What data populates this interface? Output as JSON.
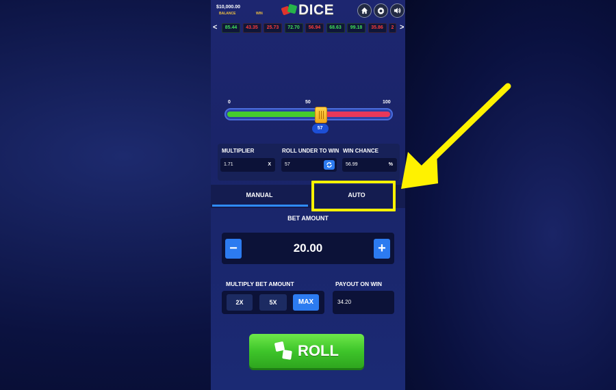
{
  "header": {
    "balance_value": "$10,000.00",
    "balance_label": "BALANCE",
    "win_label": "WIN",
    "logo_text": "DICE",
    "buttons": [
      {
        "name": "home-icon"
      },
      {
        "name": "gear-icon"
      },
      {
        "name": "sound-icon"
      }
    ]
  },
  "history": {
    "prev": "<",
    "next": ">",
    "items": [
      {
        "value": "85.44",
        "result": "win"
      },
      {
        "value": "43.35",
        "result": "loss"
      },
      {
        "value": "25.73",
        "result": "loss"
      },
      {
        "value": "72.70",
        "result": "win"
      },
      {
        "value": "56.94",
        "result": "loss"
      },
      {
        "value": "68.63",
        "result": "win"
      },
      {
        "value": "99.18",
        "result": "win"
      },
      {
        "value": "35.86",
        "result": "loss"
      },
      {
        "value": "2",
        "result": "loss"
      }
    ]
  },
  "slider": {
    "min_label": "0",
    "mid_label": "50",
    "max_label": "100",
    "value": 57,
    "value_label": "57",
    "colors": {
      "under": "#45cc2e",
      "over": "#e8385a"
    }
  },
  "stats": {
    "multiplier_label": "MULTIPLIER",
    "multiplier_value": "1.71",
    "multiplier_suffix": "X",
    "roll_under_label": "ROLL UNDER TO WIN",
    "roll_under_value": "57",
    "win_chance_label": "WIN CHANCE",
    "win_chance_value": "56.99",
    "win_chance_suffix": "%"
  },
  "tabs": [
    {
      "label": "MANUAL",
      "active": true
    },
    {
      "label": "AUTO",
      "active": false
    }
  ],
  "bet": {
    "title": "BET AMOUNT",
    "value": "20.00",
    "minus": "−",
    "plus": "+"
  },
  "multiply": {
    "title": "MULTIPLY BET AMOUNT",
    "options": [
      "2X",
      "5X",
      "MAX"
    ]
  },
  "payout": {
    "title": "PAYOUT ON WIN",
    "value": "34.20"
  },
  "roll": {
    "label": "ROLL"
  },
  "colors": {
    "accent": "#2c7bf0",
    "roll_green": "#3ec52a",
    "highlight": "#fff200"
  }
}
